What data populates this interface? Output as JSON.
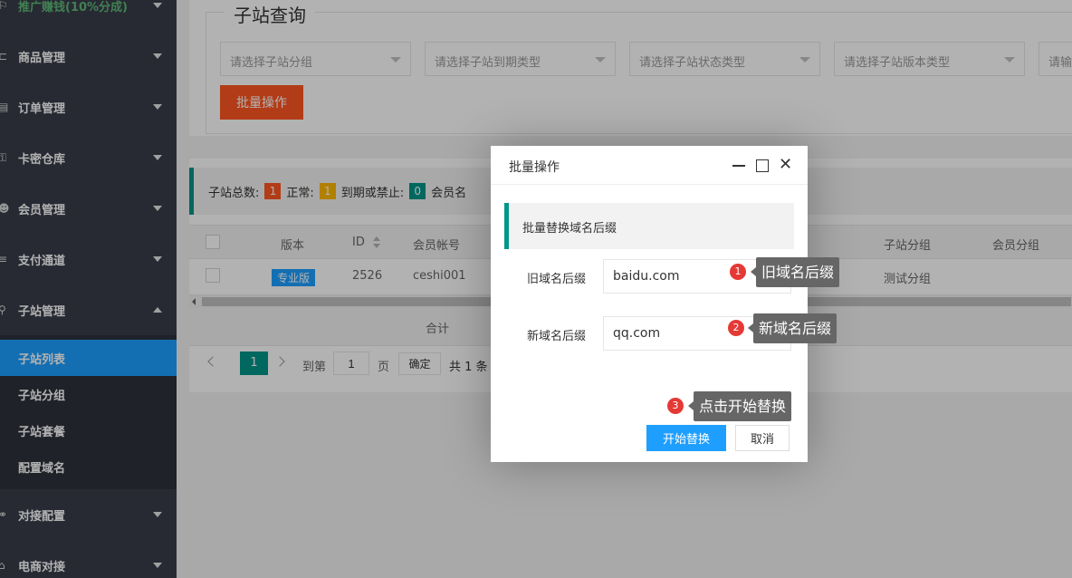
{
  "sidebar": {
    "items": [
      {
        "label": "推广赚钱(10%分成)",
        "icon": "sitemap-icon"
      },
      {
        "label": "商品管理",
        "icon": "cart-icon"
      },
      {
        "label": "订单管理",
        "icon": "list-icon"
      },
      {
        "label": "卡密仓库",
        "icon": "key-icon"
      },
      {
        "label": "会员管理",
        "icon": "users-icon"
      },
      {
        "label": "支付通道",
        "icon": "menu-icon"
      },
      {
        "label": "子站管理",
        "icon": "site-icon"
      },
      {
        "label": "对接配置",
        "icon": "link-icon"
      },
      {
        "label": "电商对接",
        "icon": "shop-icon"
      }
    ],
    "sub_items": [
      {
        "label": "子站列表"
      },
      {
        "label": "子站分组"
      },
      {
        "label": "子站套餐"
      },
      {
        "label": "配置域名"
      }
    ]
  },
  "query": {
    "legend": "子站查询",
    "selects": [
      {
        "placeholder": "请选择子站分组"
      },
      {
        "placeholder": "请选择子站到期类型"
      },
      {
        "placeholder": "请选择子站状态类型"
      },
      {
        "placeholder": "请选择子站版本类型"
      },
      {
        "placeholder": "请输"
      }
    ],
    "batch_label": "批量操作"
  },
  "stats": {
    "total_label": "子站总数:",
    "total": "1",
    "normal_label": "正常:",
    "normal": "1",
    "expired_label": "到期或禁止:",
    "expired": "0",
    "member_label": "会员名"
  },
  "table": {
    "headers": {
      "version": "版本",
      "id": "ID",
      "account": "会员帐号",
      "group": "子站分组",
      "member_group": "会员分组"
    },
    "row": {
      "version": "专业版",
      "id": "2526",
      "account": "ceshi001",
      "group": "测试分组"
    },
    "total_label": "合计"
  },
  "pager": {
    "current": "1",
    "goto_label": "到第",
    "goto_value": "1",
    "page_unit": "页",
    "confirm": "确定",
    "total": "共 1 条"
  },
  "modal": {
    "title": "批量操作",
    "section": "批量替换域名后缀",
    "old_label": "旧域名后缀",
    "old_value": "baidu.com",
    "new_label": "新域名后缀",
    "new_value": "qq.com",
    "start": "开始替换",
    "cancel": "取消"
  },
  "annotations": [
    {
      "num": "1",
      "text": "旧域名后缀"
    },
    {
      "num": "2",
      "text": "新域名后缀"
    },
    {
      "num": "3",
      "text": "点击开始替换"
    }
  ]
}
